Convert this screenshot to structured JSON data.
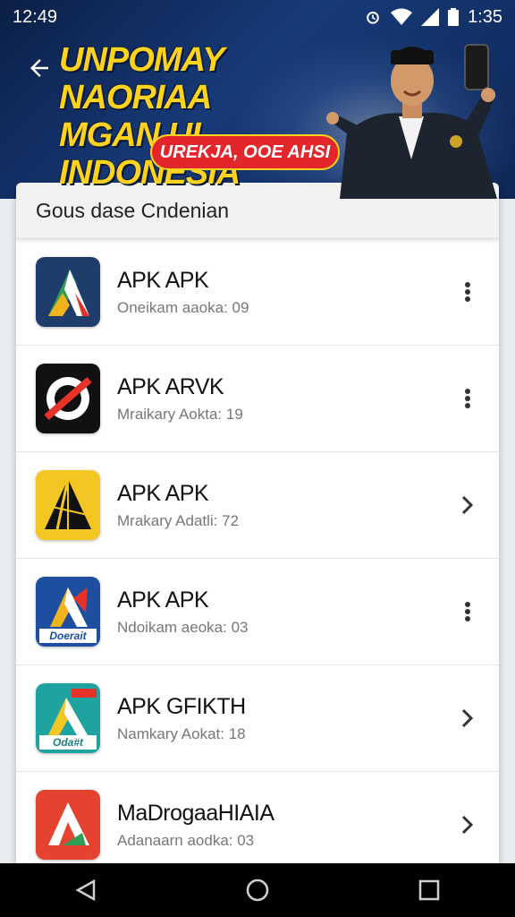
{
  "status_bar": {
    "time_left": "12:49",
    "time_right": "1:35"
  },
  "banner": {
    "title": "UNPOMAY NAORIAA\nMGAN UI INDONESIA",
    "pill": "UREKJA, OOE AHSI"
  },
  "card": {
    "header": "Gous dase Cndenian",
    "items": [
      {
        "name": "APK APK",
        "sub": "Oneikam aaoka: 09",
        "action_icon": "more-vert-icon"
      },
      {
        "name": "APK ARVK",
        "sub": "Mraikary Aokta: 19",
        "action_icon": "more-vert-icon"
      },
      {
        "name": "APK APK",
        "sub": "Mrakary Adatli: 72",
        "action_icon": "chevron-right-icon"
      },
      {
        "name": "APK APK",
        "sub": "Ndoikam aeoka: 03",
        "action_icon": "more-vert-icon"
      },
      {
        "name": "APK GFIKTH",
        "sub": "Namkary Aokat: 18",
        "action_icon": "chevron-right-icon"
      },
      {
        "name": "MaDrogaaHIAIA",
        "sub": "Adanaarn aodka: 03",
        "action_icon": "chevron-right-icon"
      }
    ]
  },
  "icon_labels": {
    "item4": "Doerait",
    "item5": "Oda#t"
  }
}
